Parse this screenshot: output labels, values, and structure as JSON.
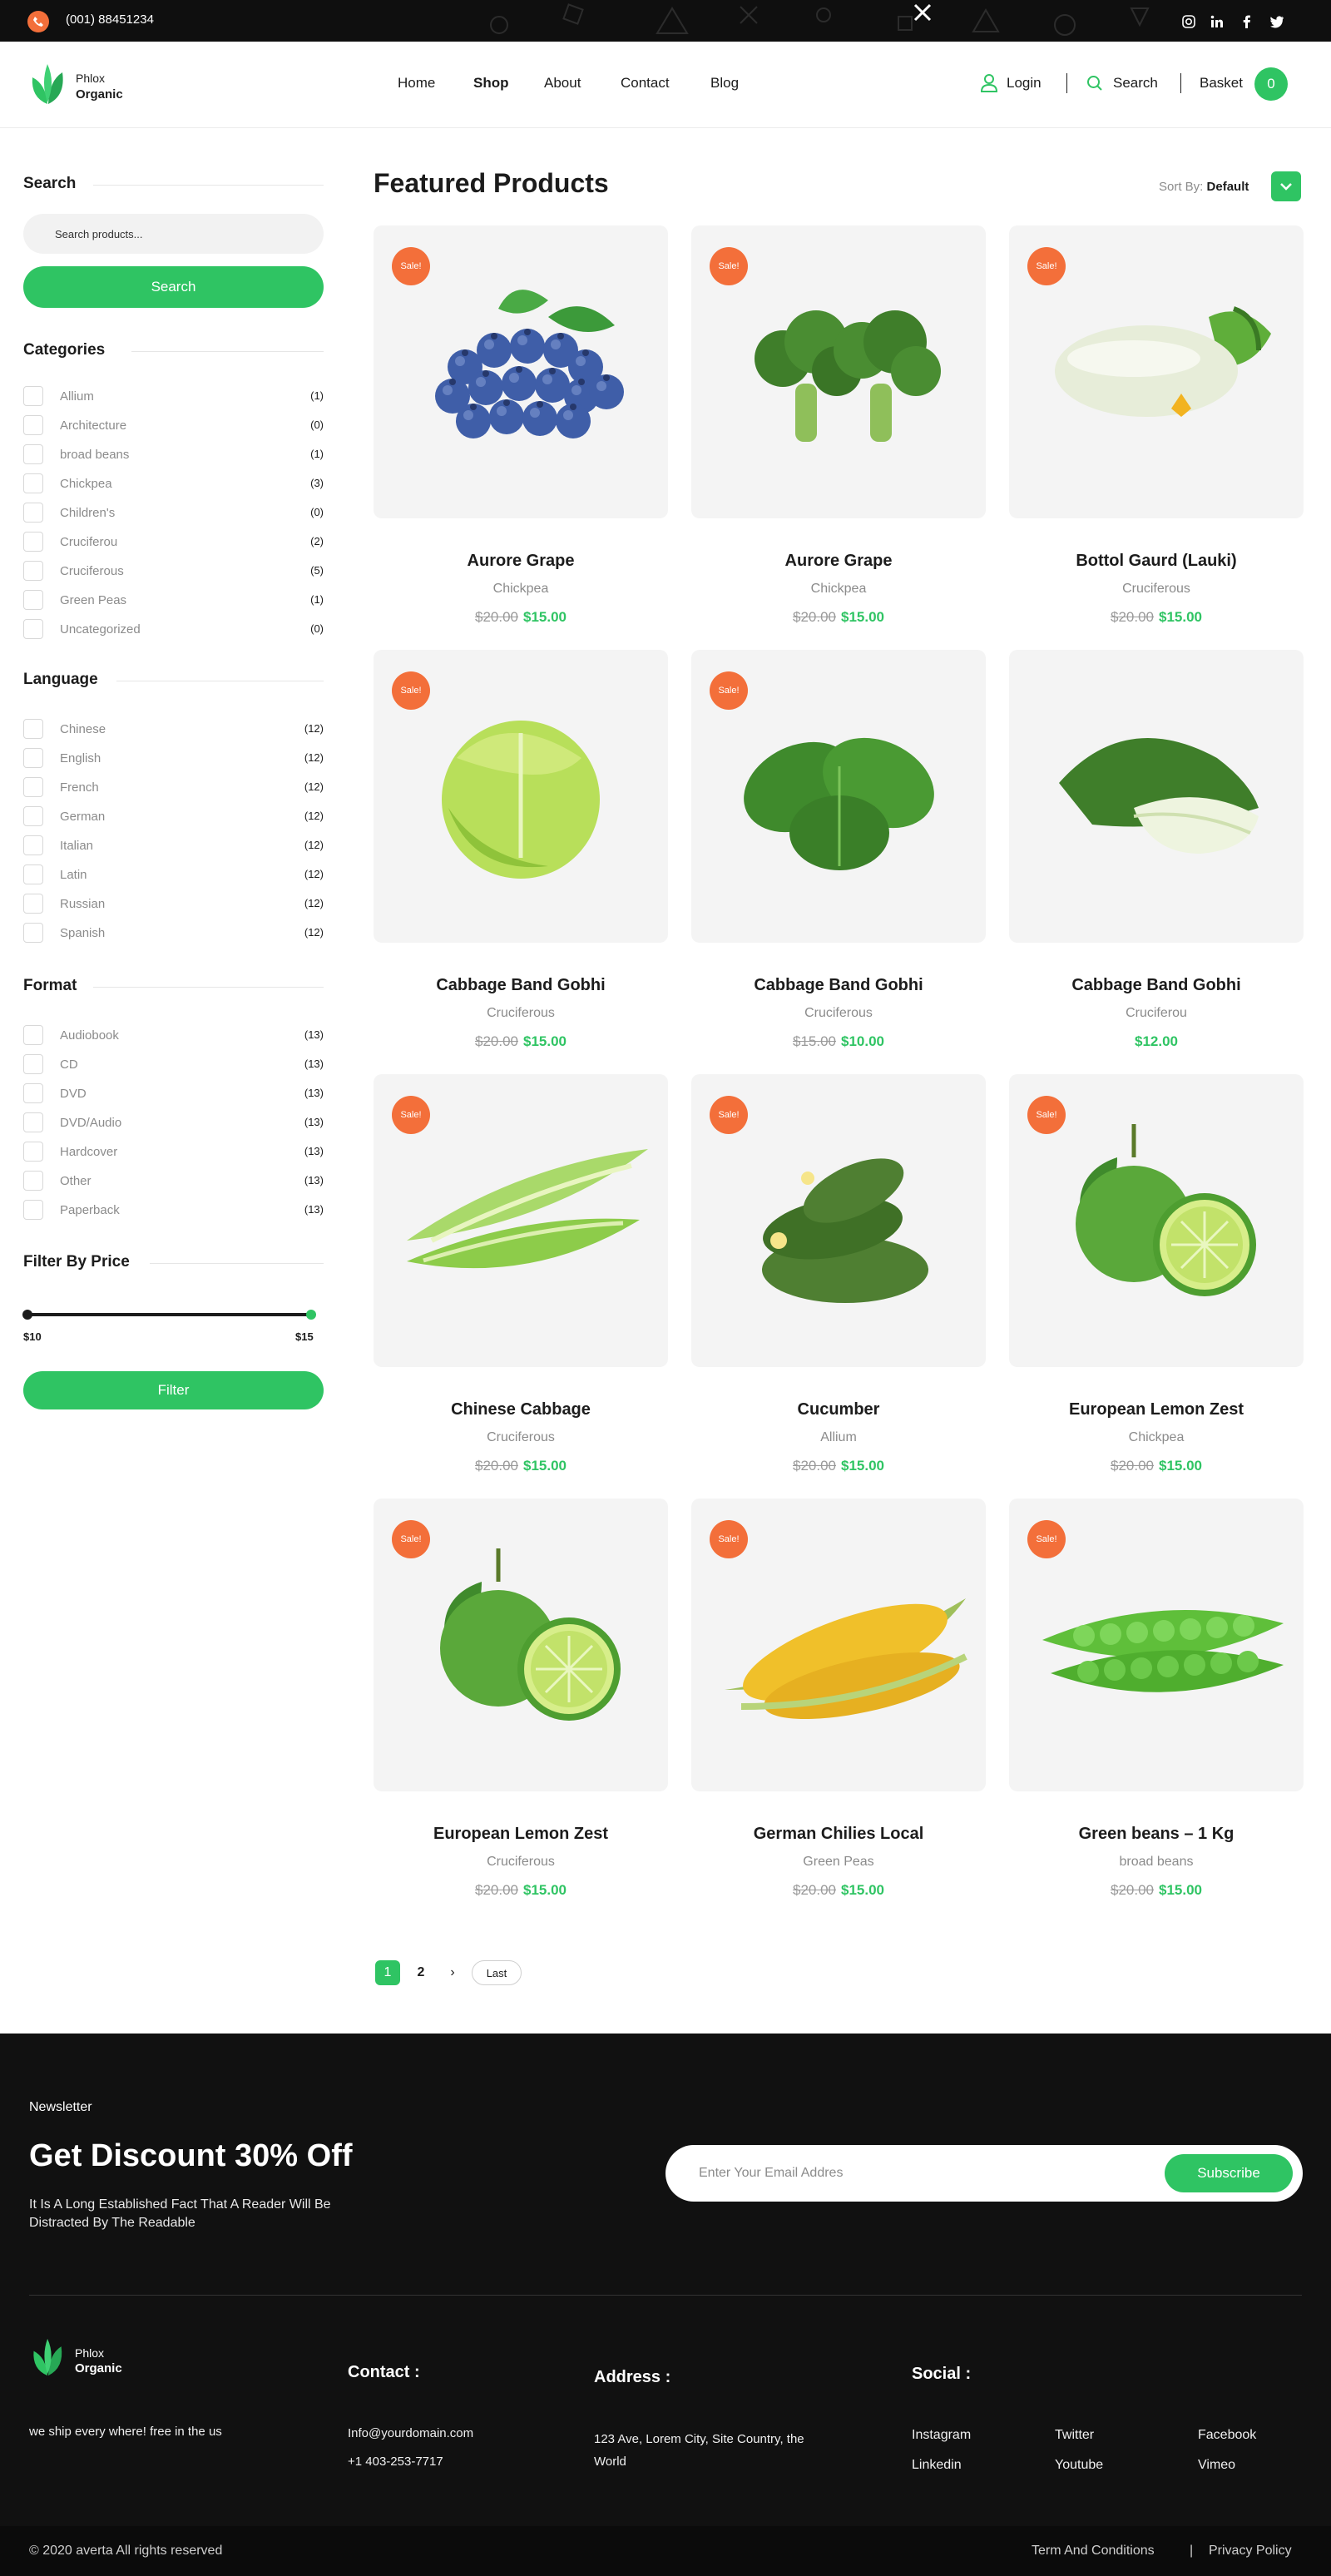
{
  "topbar": {
    "phone": "(001) 88451234",
    "social_icons": [
      "instagram-icon",
      "linkedin-icon",
      "facebook-icon",
      "twitter-icon"
    ]
  },
  "header": {
    "logo_top": "Phlox",
    "logo_bottom": "Organic",
    "nav": [
      "Home",
      "Shop",
      "About",
      "Contact",
      "Blog"
    ],
    "active_nav": "Shop",
    "login": "Login",
    "search": "Search",
    "basket": "Basket",
    "basket_count": "0"
  },
  "sidebar": {
    "search_title": "Search",
    "search_placeholder": "Search products...",
    "search_button": "Search",
    "categories_title": "Categories",
    "categories": [
      {
        "label": "Allium",
        "count": "(1)"
      },
      {
        "label": "Architecture",
        "count": "(0)"
      },
      {
        "label": "broad beans",
        "count": "(1)"
      },
      {
        "label": "Chickpea",
        "count": "(3)"
      },
      {
        "label": "Children's",
        "count": "(0)"
      },
      {
        "label": "Cruciferou",
        "count": "(2)"
      },
      {
        "label": "Cruciferous",
        "count": "(5)"
      },
      {
        "label": "Green Peas",
        "count": "(1)"
      },
      {
        "label": "Uncategorized",
        "count": "(0)"
      }
    ],
    "language_title": "Language",
    "languages": [
      {
        "label": "Chinese",
        "count": "(12)"
      },
      {
        "label": "English",
        "count": "(12)"
      },
      {
        "label": "French",
        "count": "(12)"
      },
      {
        "label": "German",
        "count": "(12)"
      },
      {
        "label": "Italian",
        "count": "(12)"
      },
      {
        "label": "Latin",
        "count": "(12)"
      },
      {
        "label": "Russian",
        "count": "(12)"
      },
      {
        "label": "Spanish",
        "count": "(12)"
      }
    ],
    "format_title": "Format",
    "formats": [
      {
        "label": "Audiobook",
        "count": "(13)"
      },
      {
        "label": "CD",
        "count": "(13)"
      },
      {
        "label": "DVD",
        "count": "(13)"
      },
      {
        "label": "DVD/Audio",
        "count": "(13)"
      },
      {
        "label": "Hardcover",
        "count": "(13)"
      },
      {
        "label": "Other",
        "count": "(13)"
      },
      {
        "label": "Paperback",
        "count": "(13)"
      }
    ],
    "price_title": "Filter By Price",
    "price_min": "$10",
    "price_max": "$15",
    "filter_button": "Filter"
  },
  "main": {
    "title": "Featured Products",
    "sort_label": "Sort By:",
    "sort_value": "Default",
    "sale_badge": "Sale!",
    "products": [
      {
        "name": "Aurore Grape",
        "category": "Chickpea",
        "old_price": "$20.00",
        "price": "$15.00",
        "image": "blueberries"
      },
      {
        "name": "Aurore Grape",
        "category": "Chickpea",
        "old_price": "$20.00",
        "price": "$15.00",
        "image": "broccoli"
      },
      {
        "name": "Bottol Gaurd (Lauki)",
        "category": "Cruciferous",
        "old_price": "$20.00",
        "price": "$15.00",
        "image": "squash"
      },
      {
        "name": "Cabbage Band Gobhi",
        "category": "Cruciferous",
        "old_price": "$20.00",
        "price": "$15.00",
        "image": "cabbage"
      },
      {
        "name": "Cabbage Band Gobhi",
        "category": "Cruciferous",
        "old_price": "$15.00",
        "price": "$10.00",
        "image": "spinach"
      },
      {
        "name": "Cabbage Band Gobhi",
        "category": "Cruciferou",
        "old_price": "",
        "price": "$12.00",
        "image": "bok-choy"
      },
      {
        "name": "Chinese Cabbage",
        "category": "Cruciferous",
        "old_price": "$20.00",
        "price": "$15.00",
        "image": "bitter-gourd"
      },
      {
        "name": "Cucumber",
        "category": "Allium",
        "old_price": "$20.00",
        "price": "$15.00",
        "image": "cucumbers"
      },
      {
        "name": "European Lemon Zest",
        "category": "Chickpea",
        "old_price": "$20.00",
        "price": "$15.00",
        "image": "lime"
      },
      {
        "name": "European Lemon Zest",
        "category": "Cruciferous",
        "old_price": "$20.00",
        "price": "$15.00",
        "image": "lime"
      },
      {
        "name": "German Chilies Local",
        "category": "Green Peas",
        "old_price": "$20.00",
        "price": "$15.00",
        "image": "corn"
      },
      {
        "name": "Green beans – 1 Kg",
        "category": "broad beans",
        "old_price": "$20.00",
        "price": "$15.00",
        "image": "peas"
      }
    ],
    "sale_flags": [
      true,
      true,
      true,
      true,
      true,
      false,
      true,
      true,
      true,
      true,
      true,
      true
    ],
    "pagination": {
      "current": "1",
      "next_page": "2",
      "next_arrow": "›",
      "last": "Last"
    }
  },
  "footer": {
    "newsletter_label": "Newsletter",
    "headline": "Get Discount 30% Off",
    "description": "It Is A Long Established Fact That A Reader Will Be Distracted By The Readable",
    "email_placeholder": "Enter Your Email Addres",
    "subscribe": "Subscribe",
    "logo_top": "Phlox",
    "logo_bottom": "Organic",
    "tagline": "we ship every where! free in the us",
    "contact_title": "Contact :",
    "contact_email": "Info@yourdomain.com",
    "contact_phone": "+1 403-253-7717",
    "address_title": "Address :",
    "address": "123 Ave, Lorem City, Site Country, the World",
    "social_title": "Social :",
    "social_links": [
      "Instagram",
      "Twitter",
      "Facebook",
      "Linkedin",
      "Youtube",
      "Vimeo"
    ],
    "copyright": "© 2020 averta All rights reserved",
    "terms": "Term And Conditions",
    "divider": "|",
    "privacy": "Privacy Policy"
  },
  "colors": {
    "accent": "#2fc463",
    "sale": "#f36f3a",
    "dark": "#111111"
  }
}
